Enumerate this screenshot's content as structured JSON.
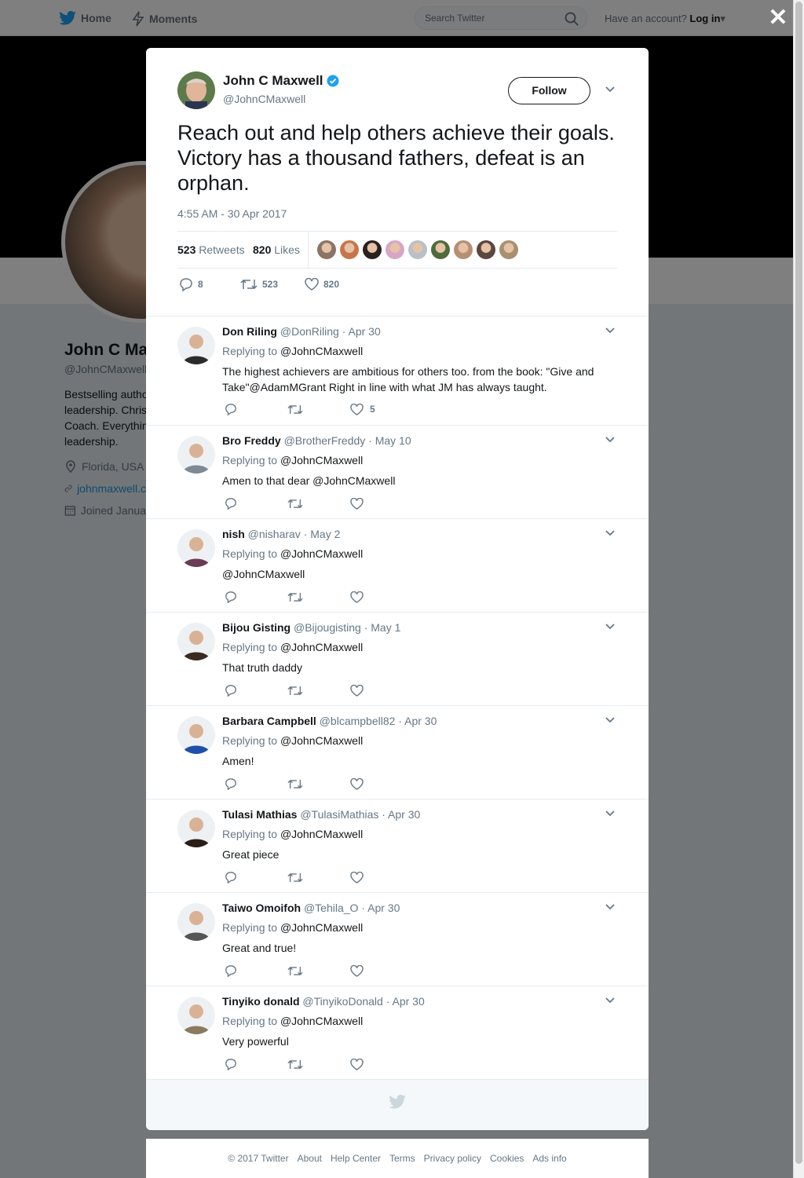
{
  "topbar": {
    "home": "Home",
    "moments": "Moments",
    "search_placeholder": "Search Twitter",
    "account_prompt": "Have an account?",
    "login": "Log in"
  },
  "profile": {
    "name": "John C Ma",
    "handle": "@JohnCMaxwell",
    "bio": [
      "Bestselling autho",
      "leadership. Chris",
      "Coach. Everythin",
      "leadership."
    ],
    "location": "Florida, USA",
    "website": "johnmaxwell.c",
    "joined": "Joined Janua"
  },
  "tweet": {
    "name": "John C Maxwell",
    "handle": "@JohnCMaxwell",
    "follow_label": "Follow",
    "text": "Reach out and help others achieve their goals. Victory has a thousand fathers, defeat is an orphan.",
    "timestamp": "4:55 AM - 30 Apr 2017",
    "retweets_count": "523",
    "retweets_label": "Retweets",
    "likes_count": "820",
    "likes_label": "Likes",
    "reply_count": "8",
    "retweet_count": "523",
    "like_count": "820",
    "liker_colors": [
      "#8a7565",
      "#c8744a",
      "#2a2020",
      "#d7a6c7",
      "#b9c0c7",
      "#4f6b3c",
      "#b59074",
      "#5c4640",
      "#a88f70"
    ]
  },
  "replies": [
    {
      "name": "Don Riling",
      "handle": "@DonRiling",
      "date": "· Apr 30",
      "replying": "Replying to",
      "to": "@JohnCMaxwell",
      "text": "The highest achievers are ambitious for others too. from the book: \"Give and Take\"@AdamMGrant  Right in line with what JM has always taught.",
      "likes": "5",
      "avatar": "#2b2b2b"
    },
    {
      "name": "Bro Freddy",
      "handle": "@BrotherFreddy",
      "date": "· May 10",
      "replying": "Replying to",
      "to": "@JohnCMaxwell",
      "text": "Amen to that dear @JohnCMaxwell",
      "likes": "",
      "avatar": "#7d8a93"
    },
    {
      "name": "nish",
      "handle": "@nisharav",
      "date": "· May 2",
      "replying": "Replying to",
      "to": "@JohnCMaxwell",
      "text": "@JohnCMaxwell",
      "likes": "",
      "avatar": "#6b3b55"
    },
    {
      "name": "Bijou Gisting",
      "handle": "@Bijougisting",
      "date": "· May 1",
      "replying": "Replying to",
      "to": "@JohnCMaxwell",
      "text": "That truth daddy",
      "likes": "",
      "avatar": "#3a2a22"
    },
    {
      "name": "Barbara Campbell",
      "handle": "@blcampbell82",
      "date": "· Apr 30",
      "replying": "Replying to",
      "to": "@JohnCMaxwell",
      "text": "Amen!",
      "likes": "",
      "avatar": "#1f4fa8"
    },
    {
      "name": "Tulasi Mathias",
      "handle": "@TulasiMathias",
      "date": "· Apr 30",
      "replying": "Replying to",
      "to": "@JohnCMaxwell",
      "text": "Great piece",
      "likes": "",
      "avatar": "#2a1e16"
    },
    {
      "name": "Taiwo Omoifoh",
      "handle": "@Tehila_O",
      "date": "· Apr 30",
      "replying": "Replying to",
      "to": "@JohnCMaxwell",
      "text": "Great and true!",
      "likes": "",
      "avatar": "#555555"
    },
    {
      "name": "Tinyiko donald",
      "handle": "@TinyikoDonald",
      "date": "· Apr 30",
      "replying": "Replying to",
      "to": "@JohnCMaxwell",
      "text": "Very powerful",
      "likes": "",
      "avatar": "#8a7a60"
    }
  ],
  "footer": [
    "© 2017 Twitter",
    "About",
    "Help Center",
    "Terms",
    "Privacy policy",
    "Cookies",
    "Ads info"
  ],
  "colors": {
    "brand": "#1da1f2",
    "link": "#1b95e0",
    "muted": "#657786"
  }
}
